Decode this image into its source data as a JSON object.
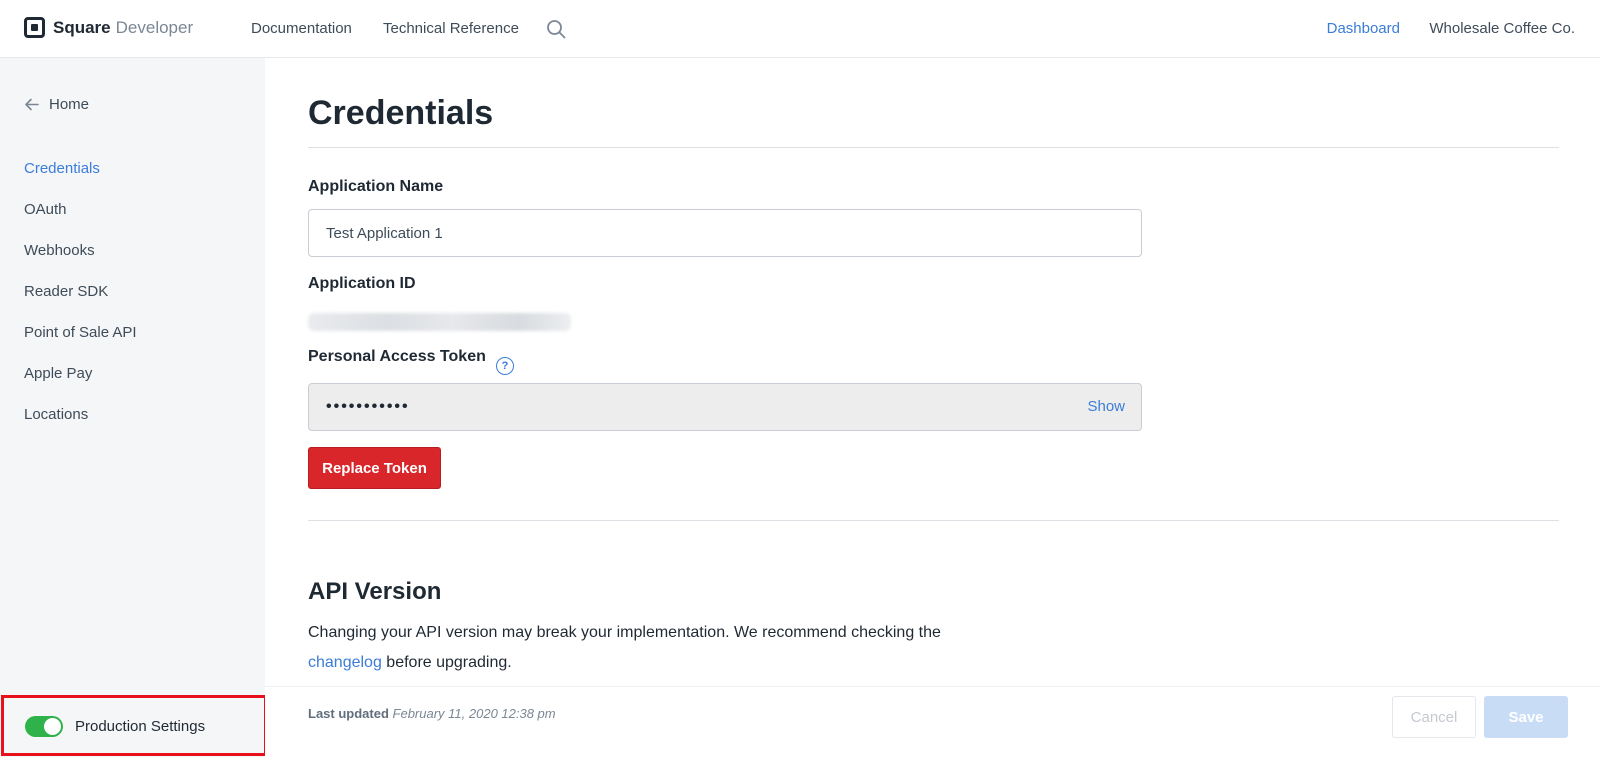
{
  "header": {
    "brand": "Square",
    "brand_suffix": "Developer",
    "nav": [
      "Documentation",
      "Technical Reference"
    ],
    "dashboard": "Dashboard",
    "account": "Wholesale Coffee Co."
  },
  "sidebar": {
    "home": "Home",
    "items": [
      {
        "label": "Credentials",
        "active": true
      },
      {
        "label": "OAuth",
        "active": false
      },
      {
        "label": "Webhooks",
        "active": false
      },
      {
        "label": "Reader SDK",
        "active": false
      },
      {
        "label": "Point of Sale API",
        "active": false
      },
      {
        "label": "Apple Pay",
        "active": false
      },
      {
        "label": "Locations",
        "active": false
      }
    ],
    "production_toggle": {
      "label": "Production Settings",
      "on": true
    }
  },
  "main": {
    "title": "Credentials",
    "app_name_label": "Application Name",
    "app_name_value": "Test Application 1",
    "app_id_label": "Application ID",
    "token_label": "Personal Access Token",
    "token_masked": "•••••••••••",
    "token_show": "Show",
    "replace_button": "Replace Token",
    "api_version_title": "API Version",
    "api_text_1": "Changing your API version may break your implementation. We recommend checking the",
    "api_link": "changelog",
    "api_text_2": "before upgrading."
  },
  "footer": {
    "last_updated_label": "Last updated",
    "last_updated_value": "February 11, 2020 12:38 pm",
    "cancel": "Cancel",
    "save": "Save"
  },
  "colors": {
    "accent": "#3b7dd8",
    "danger": "#d8262a",
    "toggle_on": "#2fb24a",
    "highlight_box": "#e8101a"
  }
}
